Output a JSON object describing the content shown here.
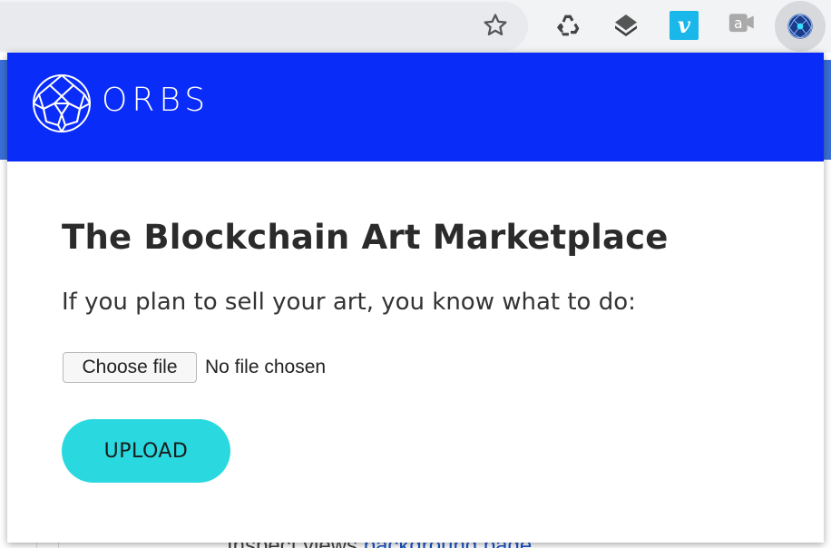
{
  "browser": {
    "toolbar_icons": [
      "star-icon",
      "recycle-icon",
      "layers-icon",
      "vimeo-icon",
      "quote-icon",
      "orbs-extension-icon"
    ],
    "vimeo_glyph": "v",
    "quote_glyph": "a"
  },
  "background_page": {
    "text_prefix": "Inspect views",
    "link_text": "background page"
  },
  "popup": {
    "brand": "ORBS",
    "title": "The Blockchain Art Marketplace",
    "subtitle": "If you plan to sell your art, you know what to do:",
    "choose_file_label": "Choose file",
    "file_status": "No file chosen",
    "upload_label": "UPLOAD"
  },
  "colors": {
    "header_blue": "#0a2cf9",
    "upload_cyan": "#29d9df",
    "title_text": "#2b2b2b"
  }
}
